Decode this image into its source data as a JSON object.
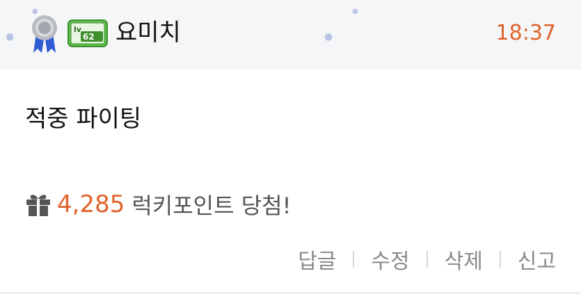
{
  "comment": {
    "author": {
      "name": "요미치",
      "level_badge": "lv 62",
      "medal_icon": "silver-medal-icon"
    },
    "timestamp": "18:37",
    "body": "적중 파이팅",
    "lucky": {
      "icon": "gift-icon",
      "points": "4,285",
      "text": "럭키포인트 당첨!"
    },
    "actions": {
      "reply": "답글",
      "edit": "수정",
      "delete": "삭제",
      "report": "신고"
    }
  },
  "colors": {
    "accent": "#e0622c",
    "header_bg": "#f5f6f8",
    "level_green": "#5fbf4a",
    "action_gray": "#8a8a8a"
  }
}
